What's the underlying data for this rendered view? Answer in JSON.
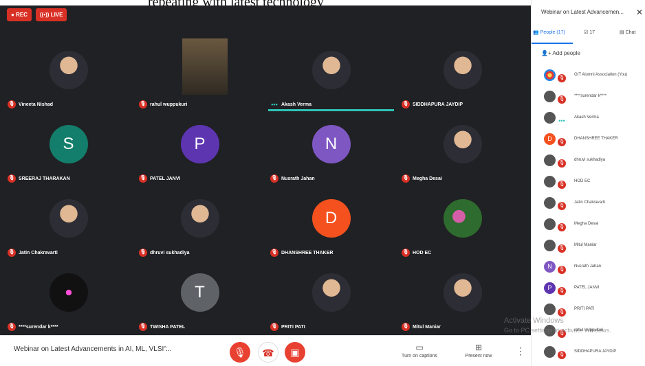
{
  "top_text": "repeating with latest technology",
  "badges": {
    "rec": "REC",
    "live": "LIVE"
  },
  "tiles": [
    {
      "name": "Vineeta Nishad",
      "avatar": "photo"
    },
    {
      "name": "rahul wuppukuri",
      "avatar": "video"
    },
    {
      "name": "Akash Verma",
      "avatar": "photo",
      "speaking": true
    },
    {
      "name": "SIDDHAPURA JAYDIP",
      "avatar": "photo"
    },
    {
      "name": "SREERAJ THARAKAN",
      "avatar": "letter",
      "letter": "S",
      "color": "#137e6b"
    },
    {
      "name": "PATEL JANVI",
      "avatar": "letter",
      "letter": "P",
      "color": "#5e35b1"
    },
    {
      "name": "Nusrath Jahan",
      "avatar": "letter",
      "letter": "N",
      "color": "#7e57c2"
    },
    {
      "name": "Megha Desai",
      "avatar": "photo"
    },
    {
      "name": "Jatin Chakravarti",
      "avatar": "photo"
    },
    {
      "name": "dhruvi sukhadiya",
      "avatar": "photo"
    },
    {
      "name": "DHANSHREE THAKER",
      "avatar": "letter",
      "letter": "D",
      "color": "#f4511e"
    },
    {
      "name": "HOD EC",
      "avatar": "flower"
    },
    {
      "name": "****surendar k****",
      "avatar": "atom"
    },
    {
      "name": "TWISHA PATEL",
      "avatar": "letter",
      "letter": "T",
      "color": "#5f6368"
    },
    {
      "name": "PRITI PATI",
      "avatar": "photo"
    },
    {
      "name": "Mitul Maniar",
      "avatar": "photo"
    }
  ],
  "controls": {
    "meeting_title": "Webinar on Latest Advancements in AI, ML, VLSI ...",
    "captions": "Turn on captions",
    "present": "Present now"
  },
  "sidebar": {
    "title": "Webinar on Latest Advancemen...",
    "tab_people": "People (17)",
    "tab_activities": "17",
    "tab_chat": "Chat",
    "add_people": "Add people",
    "participants": [
      {
        "name": "GIT Alumni Association (You)",
        "avatar": "logo"
      },
      {
        "name": "****surendar k****",
        "avatar": "atom"
      },
      {
        "name": "Akash Verma",
        "avatar": "photo",
        "speaking": true
      },
      {
        "name": "DHANSHREE THAKER",
        "avatar": "letter",
        "letter": "D",
        "color": "#f4511e"
      },
      {
        "name": "dhruvi sukhadiya",
        "avatar": "photo"
      },
      {
        "name": "HOD EC",
        "avatar": "flower"
      },
      {
        "name": "Jatin Chakravarti",
        "avatar": "photo"
      },
      {
        "name": "Megha Desai",
        "avatar": "photo"
      },
      {
        "name": "Mitul Maniar",
        "avatar": "photo"
      },
      {
        "name": "Nusrath Jahan",
        "avatar": "letter",
        "letter": "N",
        "color": "#7e57c2"
      },
      {
        "name": "PATEL JANVI",
        "avatar": "letter",
        "letter": "P",
        "color": "#5e35b1"
      },
      {
        "name": "PRITI PATI",
        "avatar": "photo"
      },
      {
        "name": "rahul wuppukuri",
        "avatar": "photo"
      },
      {
        "name": "SIDDHAPURA JAYDIP",
        "avatar": "photo"
      }
    ]
  },
  "watermark": {
    "line1": "Activate Windows",
    "line2": "Go to PC settings to activate Windows."
  }
}
